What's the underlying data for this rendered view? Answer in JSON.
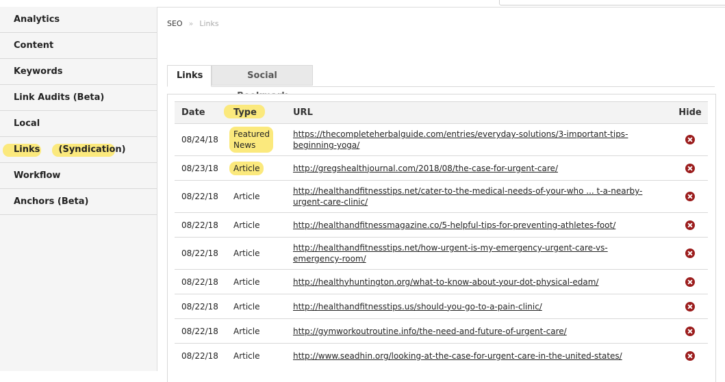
{
  "sidebar": {
    "items": [
      {
        "label": "Analytics"
      },
      {
        "label": "Content"
      },
      {
        "label": "Keywords"
      },
      {
        "label": "Link Audits (Beta)"
      },
      {
        "label": "Local"
      },
      {
        "label": "Links      (Syndication)"
      },
      {
        "label": "Workflow"
      },
      {
        "label": "Anchors (Beta)"
      }
    ]
  },
  "breadcrumb": {
    "root": "SEO",
    "sep": "»",
    "current": "Links"
  },
  "tabs": [
    {
      "label": "Links"
    },
    {
      "label": "Social Bookmark"
    }
  ],
  "table": {
    "headers": {
      "date": "Date",
      "type": "Type",
      "url": "URL",
      "hide": "Hide"
    },
    "rows": [
      {
        "date": "08/24/18",
        "type_line1": "Featured",
        "type_line2": "News",
        "url": "https://thecompleteherbalguide.com/entries/everyday-solutions/3-important-tips-",
        "url2": "beginning-yoga/"
      },
      {
        "date": "08/23/18",
        "type_line1": "Article",
        "type_line2": "",
        "url": "http://gregshealthjournal.com/2018/08/the-case-for-urgent-care/",
        "url2": ""
      },
      {
        "date": "08/22/18",
        "type_line1": "Article",
        "type_line2": "",
        "url": "http://healthandfitnesstips.net/cater-to-the-medical-needs-of-your-who ... t-a-nearby-",
        "url2": "urgent-care-clinic/"
      },
      {
        "date": "08/22/18",
        "type_line1": "Article",
        "type_line2": "",
        "url": "http://healthandfitnessmagazine.co/5-helpful-tips-for-preventing-athletes-foot/",
        "url2": ""
      },
      {
        "date": "08/22/18",
        "type_line1": "Article",
        "type_line2": "",
        "url": "http://healthandfitnesstips.net/how-urgent-is-my-emergency-urgent-care-vs-",
        "url2": "emergency-room/"
      },
      {
        "date": "08/22/18",
        "type_line1": "Article",
        "type_line2": "",
        "url": "http://healthyhuntington.org/what-to-know-about-your-dot-physical-edam/",
        "url2": ""
      },
      {
        "date": "08/22/18",
        "type_line1": "Article",
        "type_line2": "",
        "url": "http://healthandfitnesstips.us/should-you-go-to-a-pain-clinic/",
        "url2": ""
      },
      {
        "date": "08/22/18",
        "type_line1": "Article",
        "type_line2": "",
        "url": "http://gymworkoutroutine.info/the-need-and-future-of-urgent-care/",
        "url2": ""
      },
      {
        "date": "08/22/18",
        "type_line1": "Article",
        "type_line2": "",
        "url": "http://www.seadhin.org/looking-at-the-case-for-urgent-care-in-the-united-states/",
        "url2": ""
      }
    ]
  },
  "colors": {
    "highlight": "#fbe97d",
    "hide_icon": "#9b1c1c"
  },
  "icons": {
    "hide": "close-circle-icon"
  }
}
